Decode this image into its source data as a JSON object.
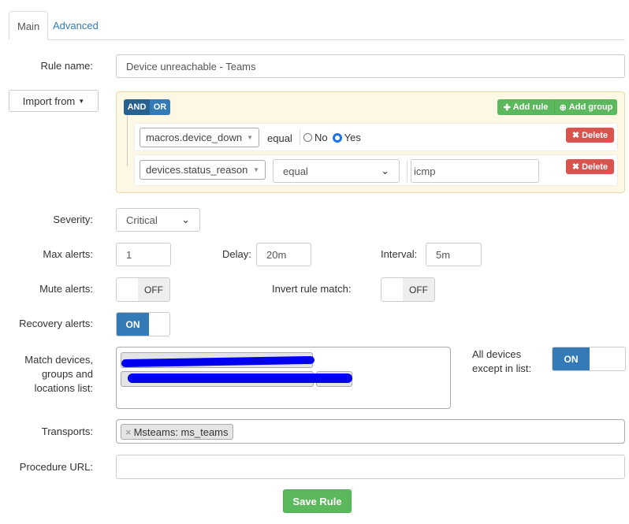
{
  "tabs": [
    {
      "label": "Main"
    },
    {
      "label": "Advanced"
    }
  ],
  "rule_name": {
    "label": "Rule name:",
    "value": "Device unreachable - Teams"
  },
  "import_from": {
    "label": "Import from"
  },
  "builder": {
    "and_label": "AND",
    "or_label": "OR",
    "add_rule": "Add rule",
    "add_group": "Add group",
    "rules": [
      {
        "field": "macros.device_down",
        "operator": "equal",
        "radio_no": "No",
        "radio_yes": "Yes",
        "selected": "Yes",
        "delete": "Delete"
      },
      {
        "field": "devices.status_reason",
        "operator": "equal",
        "value": "icmp",
        "delete": "Delete"
      }
    ]
  },
  "severity": {
    "label": "Severity:",
    "value": "Critical"
  },
  "max_alerts": {
    "label": "Max alerts:",
    "value": "1"
  },
  "delay": {
    "label": "Delay:",
    "value": "20m"
  },
  "interval": {
    "label": "Interval:",
    "value": "5m"
  },
  "mute_alerts": {
    "label": "Mute alerts:",
    "state": "OFF"
  },
  "invert_rule": {
    "label": "Invert rule match:",
    "state": "OFF"
  },
  "recovery_alerts": {
    "label": "Recovery alerts:",
    "state": "ON"
  },
  "match_devices": {
    "label_lines": [
      "Match devices,",
      "groups and",
      "locations list:"
    ]
  },
  "all_devices": {
    "label_lines": [
      "All devices",
      "except in list:"
    ],
    "state": "ON"
  },
  "transports": {
    "label": "Transports:",
    "tags": [
      "Msteams: ms_teams"
    ]
  },
  "procedure_url": {
    "label": "Procedure URL:",
    "value": ""
  },
  "save": "Save Rule",
  "colors": {
    "primary": "#337ab7",
    "success": "#5cb85c",
    "danger": "#d9534f",
    "builder_bg": "#fcf8e3"
  }
}
